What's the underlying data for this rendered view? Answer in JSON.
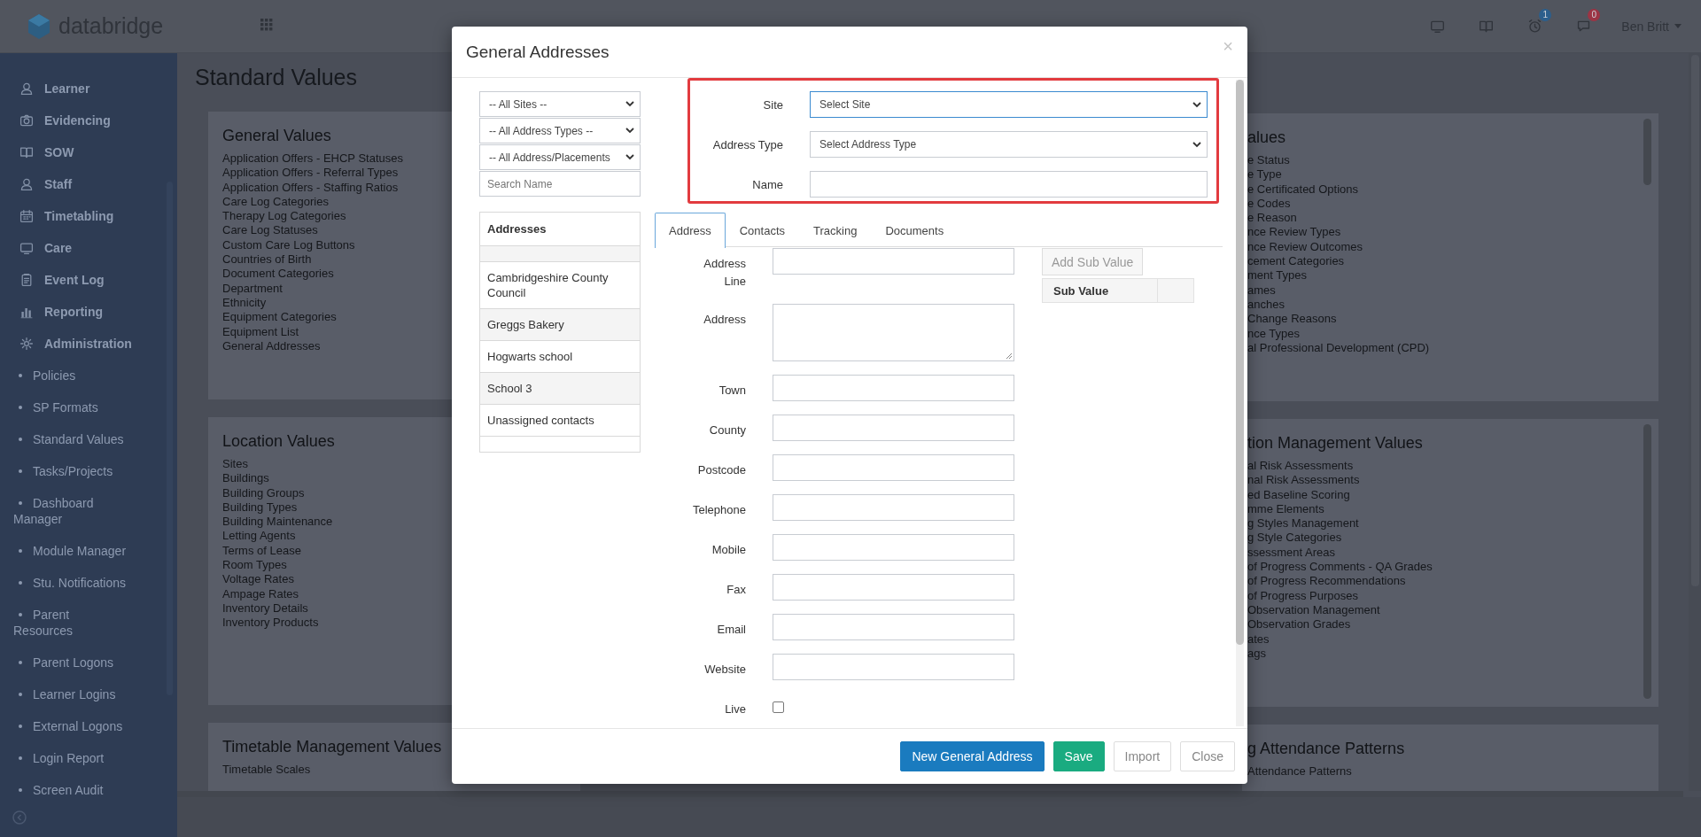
{
  "topbar": {
    "logo": "databridge",
    "icons": [
      {
        "kind": "monitor"
      },
      {
        "kind": "book"
      },
      {
        "kind": "alarm",
        "badge": "1",
        "color": "#2c5f8c"
      },
      {
        "kind": "chat",
        "badge": "0",
        "color": "#9c3444"
      }
    ],
    "user": "Ben Britt"
  },
  "sidebar": {
    "items": [
      {
        "label": "Learner",
        "kind": "person"
      },
      {
        "label": "Evidencing",
        "kind": "camera"
      },
      {
        "label": "SOW",
        "kind": "book"
      },
      {
        "label": "Staff",
        "kind": "person"
      },
      {
        "label": "Timetabling",
        "kind": "calendar"
      },
      {
        "label": "Care",
        "kind": "monitor"
      },
      {
        "label": "Event Log",
        "kind": "clipboard"
      },
      {
        "label": "Reporting",
        "kind": "chart"
      },
      {
        "label": "Administration",
        "kind": "gear",
        "children": [
          {
            "label": "Policies"
          },
          {
            "label": "SP Formats"
          },
          {
            "label": "Standard Values"
          },
          {
            "label": "Tasks/Projects"
          },
          {
            "label": "Dashboard Manager"
          },
          {
            "label": "Module Manager"
          },
          {
            "label": "Stu. Notifications"
          },
          {
            "label": "Parent Resources"
          },
          {
            "label": "Parent Logons"
          },
          {
            "label": "Learner Logins"
          },
          {
            "label": "External Logons"
          },
          {
            "label": "Login Report"
          },
          {
            "label": "Screen Audit"
          }
        ]
      }
    ]
  },
  "page": {
    "title": "Standard Values",
    "left_cards": [
      {
        "heading": "General Values",
        "items": [
          "Application Offers - EHCP Statuses",
          "Application Offers - Referral Types",
          "Application Offers - Staffing Ratios",
          "Care Log Categories",
          "Therapy Log Categories",
          "Care Log Statuses",
          "Custom Care Log Buttons",
          "Countries of Birth",
          "Document Categories",
          "Department",
          "Ethnicity",
          "Equipment Categories",
          "Equipment List",
          "General Addresses"
        ]
      },
      {
        "heading": "Location Values",
        "items": [
          "Sites",
          "Buildings",
          "Building Groups",
          "Building Types",
          "Building Maintenance",
          "Letting Agents",
          "Terms of Lease",
          "Room Types",
          "Voltage Rates",
          "Ampage Rates",
          "Inventory Details",
          "Inventory Products"
        ]
      },
      {
        "heading": "Timetable Management Values",
        "items": [
          "Timetable Scales"
        ]
      }
    ],
    "right_cards": [
      {
        "heading": "alues",
        "items": [
          "e Status",
          "e Type",
          "e Certificated Options",
          "e Codes",
          "e Reason",
          "nce Review Types",
          "nce Review Outcomes",
          "cement Categories",
          "ment Types",
          "ames",
          "anches",
          "Change Reasons",
          "nce Types",
          "al Professional Development (CPD)"
        ]
      },
      {
        "heading": "tion Management Values",
        "items": [
          "al Risk Assessments",
          "nal Risk Assessments",
          "ed Baseline Scoring",
          "mme Elements",
          "g Styles Management",
          "g Style Categories",
          "ssessment Areas",
          "of Progress Comments - QA Grades",
          "of Progress Recommendations",
          "of Progress Purposes",
          "Observation Management",
          "Observation Grades",
          "ates",
          "ags"
        ]
      },
      {
        "heading": "g Attendance Patterns",
        "items": [
          "Attendance Patterns"
        ]
      }
    ]
  },
  "modal": {
    "title": "General Addresses",
    "close": "×",
    "filters": [
      {
        "kind": "select",
        "value": "-- All Sites --"
      },
      {
        "kind": "select",
        "value": "-- All Address Types --"
      },
      {
        "kind": "select",
        "value": "-- All Address/Placements"
      },
      {
        "kind": "search",
        "placeholder": "Search Name"
      }
    ],
    "address_list": {
      "heading": "Addresses",
      "items": [
        "Cambridgeshire County Council",
        "Greggs Bakery",
        "Hogwarts school",
        "School 3",
        "Unassigned contacts"
      ]
    },
    "header_form": [
      {
        "label": "Site",
        "kind": "select",
        "value": "Select Site",
        "focused": true
      },
      {
        "label": "Address Type",
        "kind": "select",
        "value": "Select Address Type",
        "focused": false
      },
      {
        "label": "Name",
        "kind": "text",
        "focused": false
      }
    ],
    "tabs": [
      {
        "label": "Address",
        "selected": true
      },
      {
        "label": "Contacts",
        "selected": false
      },
      {
        "label": "Tracking",
        "selected": false
      },
      {
        "label": "Documents",
        "selected": false
      }
    ],
    "fields": [
      {
        "label": "Address Line",
        "kind": "text"
      },
      {
        "label": "Address",
        "kind": "textarea"
      },
      {
        "label": "Town",
        "kind": "text"
      },
      {
        "label": "County",
        "kind": "text"
      },
      {
        "label": "Postcode",
        "kind": "text"
      },
      {
        "label": "Telephone",
        "kind": "text"
      },
      {
        "label": "Mobile",
        "kind": "text"
      },
      {
        "label": "Fax",
        "kind": "text"
      },
      {
        "label": "Email",
        "kind": "text"
      },
      {
        "label": "Website",
        "kind": "text"
      },
      {
        "label": "Live",
        "kind": "checkbox",
        "checked": false
      }
    ],
    "sub_values": {
      "button": "Add Sub Value",
      "column": "Sub Value"
    },
    "buttons": [
      {
        "label": "New General Address",
        "kind": "primary"
      },
      {
        "label": "Save",
        "kind": "success"
      },
      {
        "label": "Import",
        "kind": "default"
      },
      {
        "label": "Close",
        "kind": "default"
      }
    ]
  }
}
